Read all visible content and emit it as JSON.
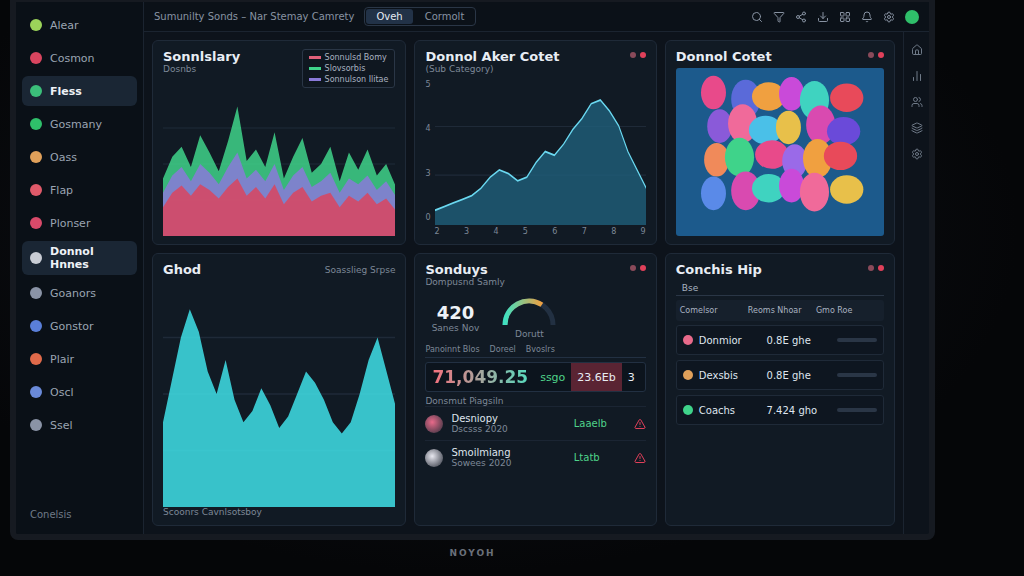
{
  "monitor": {
    "brand": "NOYOH"
  },
  "sidebar": {
    "items": [
      {
        "label": "Alear",
        "color": "#9bd35a",
        "selected": false
      },
      {
        "label": "Cosmon",
        "color": "#d9455f",
        "selected": false
      },
      {
        "label": "Fless",
        "color": "#3bbf7a",
        "selected": true
      },
      {
        "label": "Gosmany",
        "color": "#2fbf6a",
        "selected": false
      },
      {
        "label": "Oass",
        "color": "#e0a05a",
        "selected": false
      },
      {
        "label": "Flap",
        "color": "#e05a6a",
        "selected": false
      },
      {
        "label": "Plonser",
        "color": "#d94a6a",
        "selected": false
      },
      {
        "label": "Donnol Hnnes",
        "color": "#c8ccd4",
        "selected": true
      },
      {
        "label": "Goanors",
        "color": "#8a93a6",
        "selected": false
      },
      {
        "label": "Gonstor",
        "color": "#5a7fd9",
        "selected": false
      },
      {
        "label": "Plair",
        "color": "#e06a4a",
        "selected": false
      },
      {
        "label": "Oscl",
        "color": "#6a8ad9",
        "selected": false
      },
      {
        "label": "Ssel",
        "color": "#8a93a6",
        "selected": false
      }
    ],
    "footer": "Conelsis"
  },
  "topbar": {
    "breadcrumb": "Sumunilty Sonds – Nar Stemay Camrety",
    "tabs": [
      {
        "label": "Oveh",
        "selected": true
      },
      {
        "label": "Cormolt",
        "selected": false
      }
    ]
  },
  "trend_panel": {
    "title": "Sonnlslary",
    "subtitle": "Dosnbs",
    "legend": [
      {
        "label": "Sonnulsd Bomy",
        "color": "#e0607a"
      },
      {
        "label": "Slovsorbis",
        "color": "#3fd38a"
      },
      {
        "label": "Sonnulson Ilitae",
        "color": "#8a7ad9"
      }
    ],
    "series": [
      {
        "name": "green",
        "color": "#3fd38a",
        "values": [
          40,
          55,
          62,
          48,
          70,
          58,
          45,
          66,
          90,
          52,
          60,
          48,
          72,
          40,
          55,
          68,
          44,
          50,
          62,
          38,
          58,
          46,
          60,
          42,
          50,
          35
        ]
      },
      {
        "name": "purple",
        "color": "#8a7ad9",
        "values": [
          30,
          42,
          48,
          38,
          50,
          44,
          36,
          48,
          58,
          40,
          46,
          38,
          50,
          32,
          42,
          48,
          34,
          38,
          44,
          30,
          40,
          36,
          42,
          32,
          38,
          28
        ]
      },
      {
        "name": "red",
        "color": "#d9455f",
        "values": [
          20,
          30,
          35,
          28,
          36,
          32,
          26,
          34,
          40,
          28,
          34,
          26,
          36,
          22,
          30,
          34,
          24,
          28,
          30,
          20,
          28,
          24,
          30,
          22,
          26,
          18
        ]
      }
    ]
  },
  "area_panel": {
    "title": "Donnol Aker Cotet",
    "subtitle": "(Sub Category)",
    "y_ticks": [
      "5",
      "4",
      "3",
      "0"
    ],
    "x_ticks": [
      "2",
      "3",
      "4",
      "5",
      "6",
      "7",
      "8",
      "9"
    ],
    "values": [
      8,
      10,
      12,
      14,
      16,
      20,
      26,
      30,
      28,
      24,
      26,
      34,
      40,
      38,
      44,
      52,
      58,
      66,
      68,
      62,
      54,
      40,
      30,
      20
    ]
  },
  "map_panel": {
    "title": "Donnol Cotet",
    "regions": [
      {
        "color": "#e84a8a"
      },
      {
        "color": "#5a6ad9"
      },
      {
        "color": "#f0a040"
      },
      {
        "color": "#c94ad9"
      },
      {
        "color": "#3fd3c0"
      },
      {
        "color": "#e84a5a"
      },
      {
        "color": "#8a5ad9"
      },
      {
        "color": "#f06a9a"
      },
      {
        "color": "#4ac0e8"
      },
      {
        "color": "#e8c04a"
      },
      {
        "color": "#d94ab0"
      },
      {
        "color": "#6a4ad9"
      },
      {
        "color": "#f08a5a"
      },
      {
        "color": "#3fd38a"
      },
      {
        "color": "#e84a8a"
      },
      {
        "color": "#9a6ae8"
      },
      {
        "color": "#f0a040"
      },
      {
        "color": "#e84a5a"
      },
      {
        "color": "#5a8ae8"
      },
      {
        "color": "#d94ab0"
      },
      {
        "color": "#3fd3c0"
      },
      {
        "color": "#c94ad9"
      },
      {
        "color": "#f06a9a"
      },
      {
        "color": "#e8c04a"
      }
    ]
  },
  "wave_panel": {
    "title": "Ghod",
    "legend": "Soasslieg Srpse",
    "footer": "Scoonrs Cavnlsotsboy",
    "values": [
      30,
      45,
      60,
      70,
      62,
      48,
      40,
      52,
      38,
      30,
      34,
      42,
      36,
      28,
      32,
      40,
      48,
      44,
      38,
      30,
      26,
      30,
      40,
      52,
      60,
      48,
      36
    ]
  },
  "summary_panel": {
    "title": "Sonduys",
    "subtitle": "Dompusnd Samly",
    "stat": {
      "value": "420",
      "label": "Sanes Nov"
    },
    "gauge": {
      "level": 0.68,
      "label": "Dorutt"
    },
    "header": [
      "Panoinnt Blos",
      "Doreel",
      "Bvoslrs"
    ],
    "metrics": [
      {
        "value": "71,049.25",
        "kind": "big"
      },
      {
        "value": "ssgo",
        "kind": "tag"
      },
      {
        "value": "23.6Eb",
        "kind": "alert"
      },
      {
        "value": "3",
        "kind": "plain"
      }
    ],
    "caption": "Donsmut Piagsiln",
    "rows": [
      {
        "title": "Desniopy",
        "sub": "Dscsss 2020",
        "status": "Laaelb",
        "color": "#e86a8a"
      },
      {
        "title": "Smoilmiang",
        "sub": "Sowees 2020",
        "status": "Ltatb",
        "color": "#e8e8f0"
      }
    ]
  },
  "table_panel": {
    "title": "Conchis Hip",
    "tab": "Bse",
    "columns": [
      "Comelsor",
      "Reoms Nhoar",
      "Gmo Roe"
    ],
    "rows": [
      {
        "name": "Donmior",
        "value": "0.8E ghe",
        "color": "#e86a8a"
      },
      {
        "name": "Dexsbis",
        "value": "0.8E ghe",
        "color": "#e0a05a"
      },
      {
        "name": "Coachs",
        "value": "7.424 gho",
        "color": "#3fd38a"
      }
    ]
  }
}
